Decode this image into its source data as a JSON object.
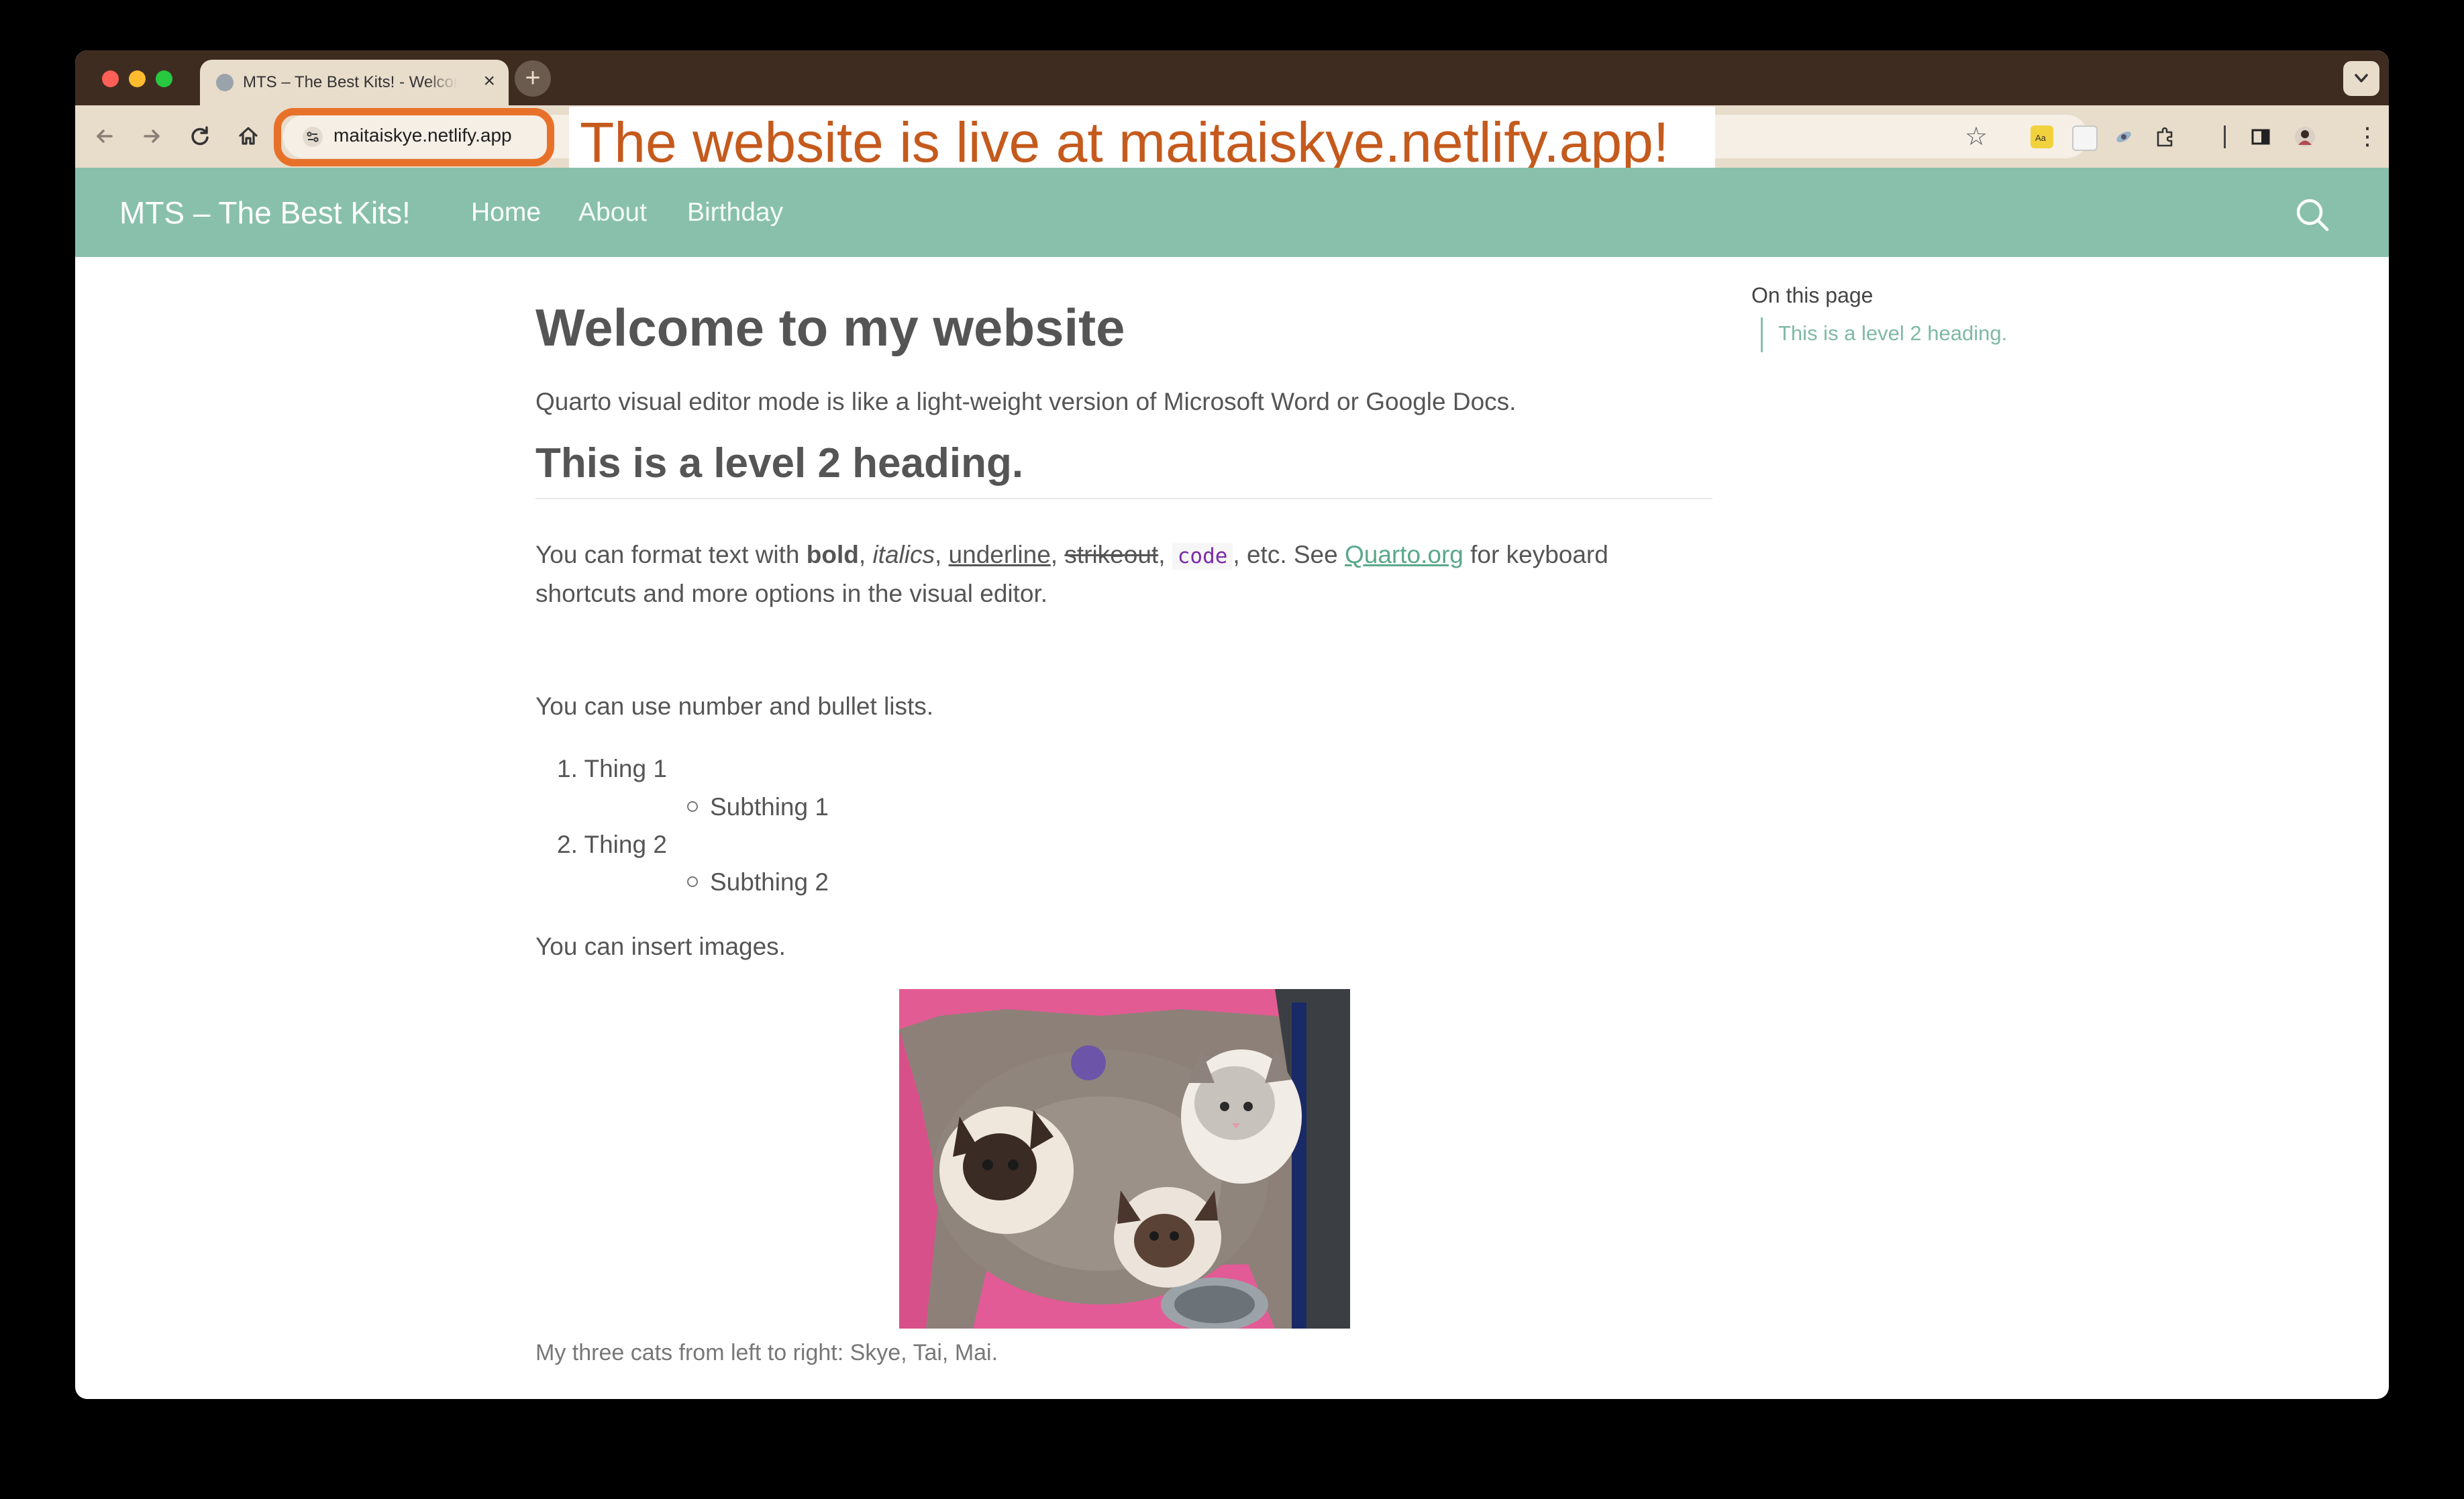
{
  "browser": {
    "tab_title": "MTS – The Best Kits! - Welcome to my website",
    "url": "maitaiskye.netlify.app",
    "annotation": "The website is live at maitaiskye.netlify.app!"
  },
  "colors": {
    "tabstrip": "#3f2c21",
    "toolbar": "#e8dccb",
    "navbar": "#88c0ac",
    "highlight": "#e8712a",
    "annotation_text": "#c55a1d",
    "link": "#5aa88b"
  },
  "site": {
    "brand": "MTS – The Best Kits!",
    "nav": [
      "Home",
      "About",
      "Birthday"
    ],
    "search_icon": "search-icon"
  },
  "page": {
    "title": "Welcome to my website",
    "intro": "Quarto visual editor mode is like a light-weight version of Microsoft Word or Google Docs.",
    "h2": "This is a level 2 heading.",
    "format": {
      "lead": "You can format text with ",
      "bold": "bold",
      "sep1": ", ",
      "italics": "italics",
      "sep2": ", ",
      "underline": "underline",
      "sep3": ", ",
      "strikeout": "strikeout",
      "sep4": ", ",
      "code": "code",
      "mid": ", etc. See ",
      "link": "Quarto.org",
      "tail": " for keyboard",
      "line2": "shortcuts and more options in the visual editor."
    },
    "lists_intro": "You can use number and bullet lists.",
    "list": [
      {
        "num": "1.",
        "label": "Thing 1",
        "sub": "Subthing 1"
      },
      {
        "num": "2.",
        "label": "Thing 2",
        "sub": "Subthing 2"
      }
    ],
    "images_intro": "You can insert images.",
    "caption": "My three cats from left to right: Skye, Tai, Mai."
  },
  "toc": {
    "title": "On this page",
    "items": [
      "This is a level 2 heading."
    ]
  }
}
